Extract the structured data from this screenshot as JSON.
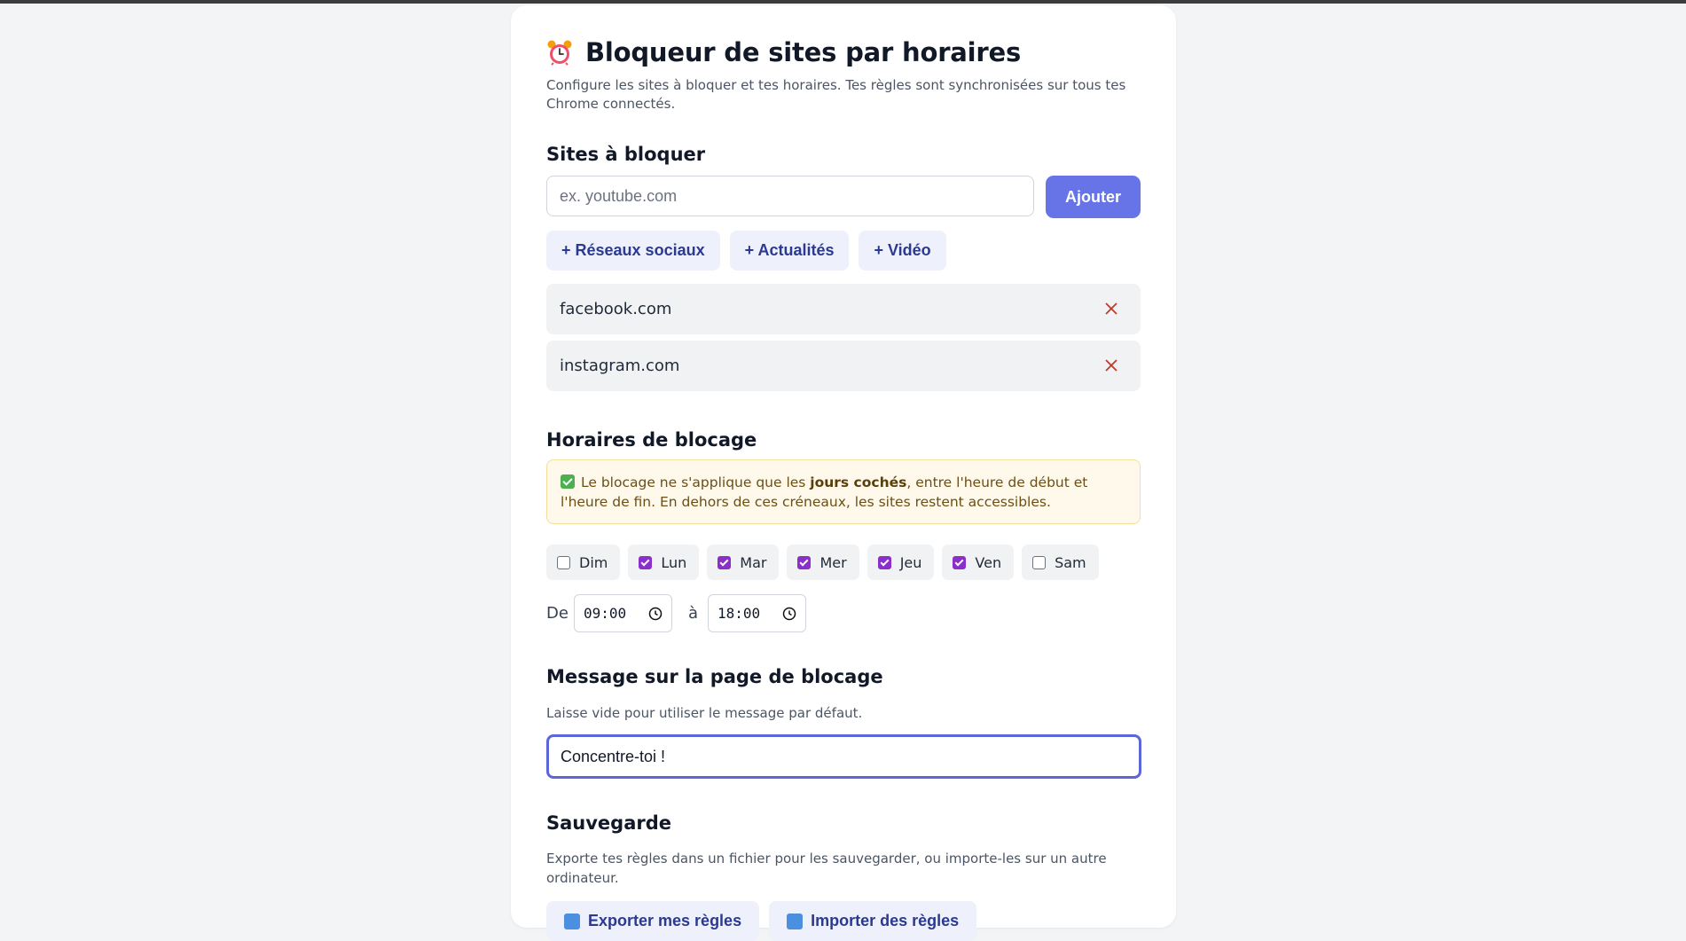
{
  "header": {
    "title": "Bloqueur de sites par horaires",
    "subtitle": "Configure les sites à bloquer et tes horaires. Tes règles sont synchronisées sur tous tes Chrome connectés.",
    "icon": "alarm-clock-icon"
  },
  "sites_section": {
    "heading": "Sites à bloquer",
    "input_placeholder": "ex. youtube.com",
    "input_value": "",
    "add_label": "Ajouter",
    "presets": [
      "+ Réseaux sociaux",
      "+ Actualités",
      "+ Vidéo"
    ],
    "sites": [
      "facebook.com",
      "instagram.com"
    ]
  },
  "schedule_section": {
    "heading": "Horaires de blocage",
    "notice_before": "Le blocage ne s'applique que les ",
    "notice_bold": "jours cochés",
    "notice_after": ", entre l'heure de début et l'heure de fin. En dehors de ces créneaux, les sites restent accessibles.",
    "days": [
      {
        "label": "Dim",
        "checked": false
      },
      {
        "label": "Lun",
        "checked": true
      },
      {
        "label": "Mar",
        "checked": true
      },
      {
        "label": "Mer",
        "checked": true
      },
      {
        "label": "Jeu",
        "checked": true
      },
      {
        "label": "Ven",
        "checked": true
      },
      {
        "label": "Sam",
        "checked": false
      }
    ],
    "from_label": "De",
    "from_time": "09:00",
    "to_label": "à",
    "to_time": "18:00"
  },
  "message_section": {
    "heading": "Message sur la page de blocage",
    "hint": "Laisse vide pour utiliser le message par défaut.",
    "value": "Concentre-toi !"
  },
  "backup_section": {
    "heading": "Sauvegarde",
    "hint": "Exporte tes règles dans un fichier pour les sauvegarder, ou importe-les sur un autre ordinateur.",
    "export_label": "Exporter mes règles",
    "import_label": "Importer des règles"
  },
  "colors": {
    "accent": "#6674e8",
    "checkbox": "#8b2fc9",
    "remove": "#c0392b"
  }
}
